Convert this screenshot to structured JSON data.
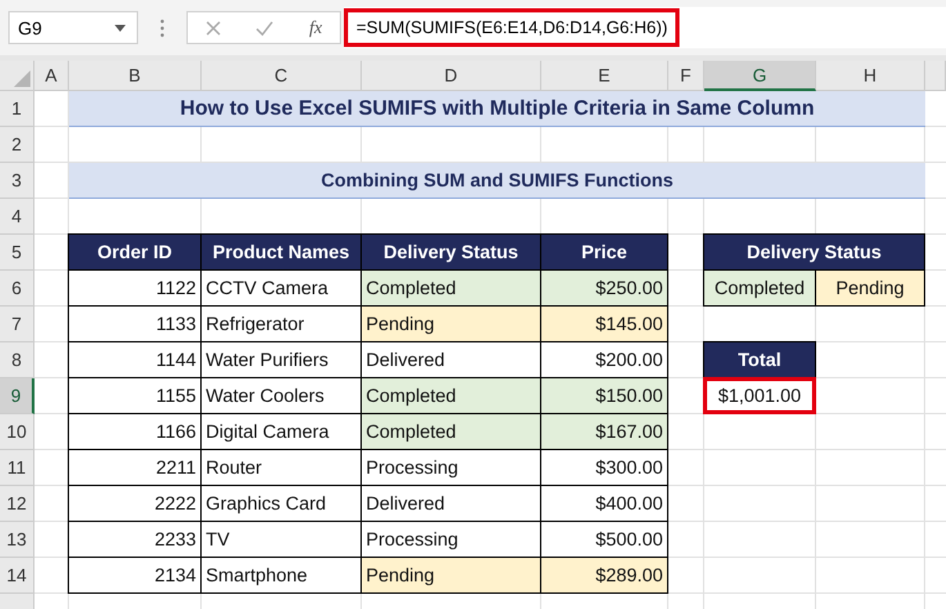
{
  "formula_bar": {
    "name_box": "G9",
    "function_label": "fx",
    "formula": "=SUM(SUMIFS(E6:E14,D6:D14,G6:H6))"
  },
  "column_headers": [
    {
      "label": "A",
      "selected": false
    },
    {
      "label": "B",
      "selected": false
    },
    {
      "label": "C",
      "selected": false
    },
    {
      "label": "D",
      "selected": false
    },
    {
      "label": "E",
      "selected": false
    },
    {
      "label": "F",
      "selected": false
    },
    {
      "label": "G",
      "selected": true
    },
    {
      "label": "H",
      "selected": false
    }
  ],
  "row_headers": [
    {
      "label": "1",
      "selected": false
    },
    {
      "label": "2",
      "selected": false
    },
    {
      "label": "3",
      "selected": false
    },
    {
      "label": "4",
      "selected": false
    },
    {
      "label": "5",
      "selected": false
    },
    {
      "label": "6",
      "selected": false
    },
    {
      "label": "7",
      "selected": false
    },
    {
      "label": "8",
      "selected": false
    },
    {
      "label": "9",
      "selected": true
    },
    {
      "label": "10",
      "selected": false
    },
    {
      "label": "11",
      "selected": false
    },
    {
      "label": "12",
      "selected": false
    },
    {
      "label": "13",
      "selected": false
    },
    {
      "label": "14",
      "selected": false
    }
  ],
  "title": "How to Use Excel SUMIFS with Multiple Criteria in Same Column",
  "subtitle": "Combining SUM and SUMIFS Functions",
  "table": {
    "columns": [
      "Order ID",
      "Product Names",
      "Delivery Status",
      "Price"
    ],
    "rows": [
      {
        "order_id": "1122",
        "product": "CCTV Camera",
        "status": "Completed",
        "price": "$250.00",
        "color": "#e2efda"
      },
      {
        "order_id": "1133",
        "product": "Refrigerator",
        "status": "Pending",
        "price": "$145.00",
        "color": "#fff2cc"
      },
      {
        "order_id": "1144",
        "product": "Water Purifiers",
        "status": "Delivered",
        "price": "$200.00"
      },
      {
        "order_id": "1155",
        "product": "Water Coolers",
        "status": "Completed",
        "price": "$150.00",
        "color": "#e2efda"
      },
      {
        "order_id": "1166",
        "product": "Digital Camera",
        "status": "Completed",
        "price": "$167.00",
        "color": "#e2efda"
      },
      {
        "order_id": "2211",
        "product": "Router",
        "status": "Processing",
        "price": "$300.00"
      },
      {
        "order_id": "2222",
        "product": "Graphics Card",
        "status": "Delivered",
        "price": "$400.00"
      },
      {
        "order_id": "2233",
        "product": "TV",
        "status": "Processing",
        "price": "$500.00"
      },
      {
        "order_id": "2134",
        "product": "Smartphone",
        "status": "Pending",
        "price": "$289.00",
        "color": "#fff2cc"
      }
    ]
  },
  "criteria": {
    "header": "Delivery Status",
    "values": [
      {
        "label": "Completed",
        "color": "#e2efda"
      },
      {
        "label": "Pending",
        "color": "#fff2cc"
      }
    ]
  },
  "total": {
    "header": "Total",
    "value": "$1,001.00",
    "selected": true
  }
}
